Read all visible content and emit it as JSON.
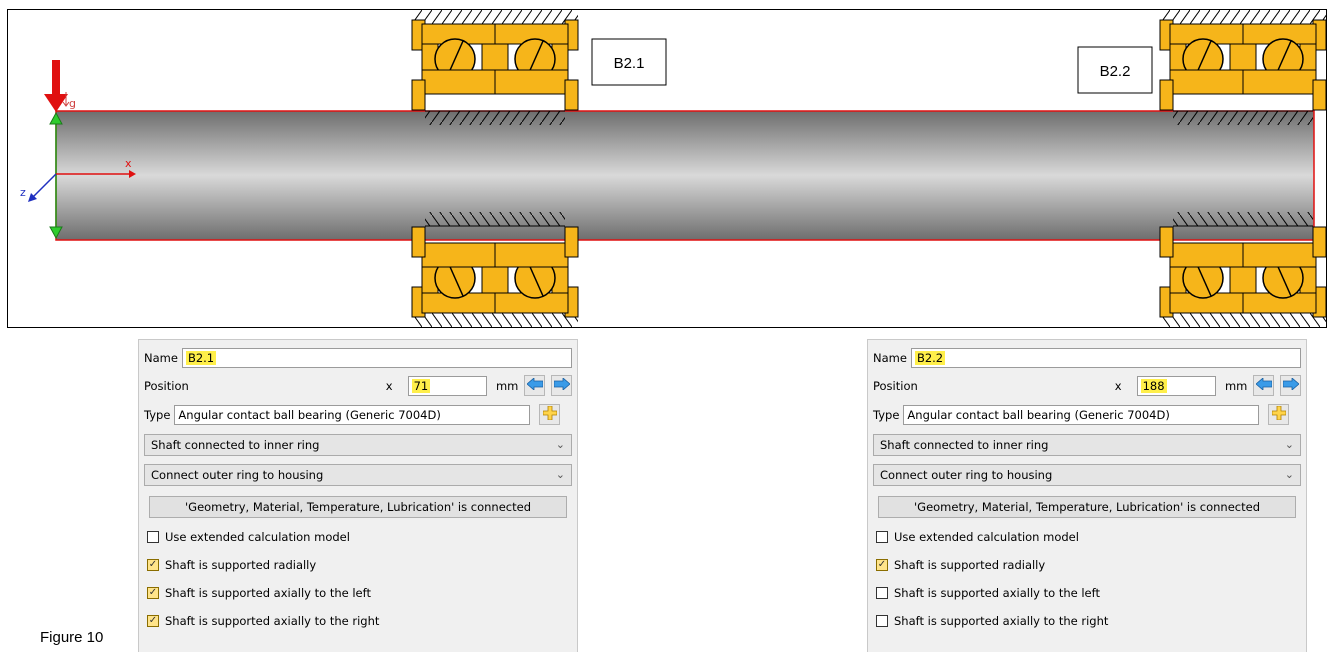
{
  "figure_caption": "Figure 10",
  "diagram": {
    "bearing_labels": [
      "B2.1",
      "B2.2"
    ],
    "axis_x_label": "x",
    "axis_z_label": "z",
    "gravity_label": "g"
  },
  "panels": [
    {
      "name_label": "Name",
      "name_value": "B2.1",
      "position_label": "Position",
      "x_label": "x",
      "x_value": "71",
      "unit": "mm",
      "type_label": "Type",
      "type_value": "Angular contact ball bearing (Generic 7004D)",
      "inner_ring_select": "Shaft connected to inner ring",
      "outer_ring_select": "Connect outer ring to housing",
      "connected_button": "'Geometry, Material, Temperature, Lubrication' is connected",
      "checkboxes": [
        {
          "label": "Use extended calculation model",
          "checked": false
        },
        {
          "label": "Shaft is supported radially",
          "checked": true
        },
        {
          "label": "Shaft is supported axially to the left",
          "checked": true
        },
        {
          "label": "Shaft is supported axially to the right",
          "checked": true
        }
      ]
    },
    {
      "name_label": "Name",
      "name_value": "B2.2",
      "position_label": "Position",
      "x_label": "x",
      "x_value": "188",
      "unit": "mm",
      "type_label": "Type",
      "type_value": "Angular contact ball bearing (Generic 7004D)",
      "inner_ring_select": "Shaft connected to inner ring",
      "outer_ring_select": "Connect outer ring to housing",
      "connected_button": "'Geometry, Material, Temperature, Lubrication' is connected",
      "checkboxes": [
        {
          "label": "Use extended calculation model",
          "checked": false
        },
        {
          "label": "Shaft is supported radially",
          "checked": true
        },
        {
          "label": "Shaft is supported axially to the left",
          "checked": false
        },
        {
          "label": "Shaft is supported axially to the right",
          "checked": false
        }
      ]
    }
  ],
  "colors": {
    "bearing_fill": "#f6b51a",
    "shaft_outline": "#e01010",
    "load_arrow": "#e01010",
    "highlight": "#ffef4a"
  }
}
